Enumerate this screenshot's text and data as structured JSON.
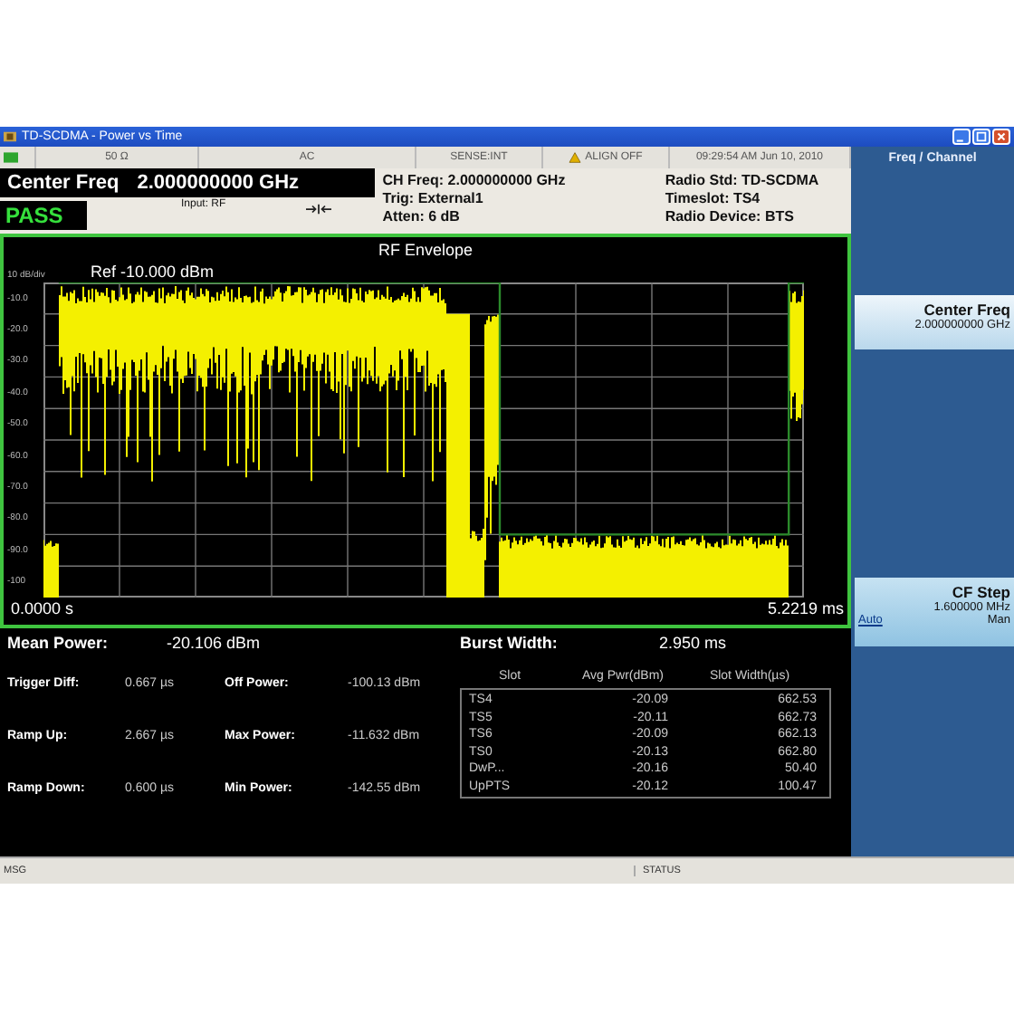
{
  "window": {
    "title": "TD-SCDMA - Power vs Time"
  },
  "status_bar": {
    "items": [
      {
        "text": "50 Ω",
        "kind": "plain"
      },
      {
        "text": "AC",
        "kind": "plain"
      },
      {
        "text": "SENSE:INT",
        "kind": "plain"
      },
      {
        "text": "ALIGN OFF",
        "kind": "warning"
      },
      {
        "text": "09:29:54 AM Jun 10, 2010",
        "kind": "plain"
      }
    ]
  },
  "header": {
    "center_freq_label": "Center Freq",
    "center_freq_value": "2.000000000 GHz",
    "result": {
      "text": "PASS",
      "passed": true
    },
    "input": "Input: RF",
    "middle": [
      "CH Freq: 2.000000000 GHz",
      "Trig: External1",
      "Atten: 6 dB"
    ],
    "right": [
      "Radio Std: TD-SCDMA",
      "Timeslot: TS4",
      "Radio Device: BTS"
    ]
  },
  "plot": {
    "title": "RF Envelope",
    "scale": "10 dB/div",
    "ref": "Ref -10.000 dBm",
    "y_axis_labels": [
      "-10.0",
      "-20.0",
      "-30.0",
      "-40.0",
      "-50.0",
      "-60.0",
      "-70.0",
      "-80.0",
      "-90.0",
      "-100"
    ],
    "x_start": "0.0000 s",
    "x_stop": "5.2219 ms"
  },
  "results": {
    "mean_power_label": "Mean Power:",
    "mean_power": "-20.106 dBm",
    "burst_width_label": "Burst Width:",
    "burst_width": "2.950 ms",
    "metrics": [
      {
        "label": "Trigger Diff:",
        "value": "0.667 µs"
      },
      {
        "label": "Off Power:",
        "value": "-100.13 dBm"
      },
      {
        "label": "Ramp Up:",
        "value": "2.667 µs"
      },
      {
        "label": "Max Power:",
        "value": "-11.632 dBm"
      },
      {
        "label": "Ramp Down:",
        "value": "0.600 µs"
      },
      {
        "label": "Min Power:",
        "value": "-142.55 dBm"
      }
    ],
    "table": {
      "columns": [
        "Slot",
        "Avg Pwr(dBm)",
        "Slot Width(µs)"
      ],
      "rows": [
        [
          "TS4",
          "-20.09",
          "662.53"
        ],
        [
          "TS5",
          "-20.11",
          "662.73"
        ],
        [
          "TS6",
          "-20.09",
          "662.13"
        ],
        [
          "TS0",
          "-20.13",
          "662.80"
        ],
        [
          "DwP...",
          "-20.16",
          "50.40"
        ],
        [
          "UpPTS",
          "-20.12",
          "100.47"
        ]
      ]
    }
  },
  "bottom_bar": {
    "message_label": "MSG",
    "status_label": "STATUS"
  },
  "side_panel": {
    "title": "Freq / Channel",
    "softkeys": [
      {
        "kind": "value",
        "label": "Center Freq",
        "value": "2.000000000 GHz"
      },
      {
        "kind": "toggle",
        "label": "CF Step",
        "value": "1.600000 MHz",
        "options": [
          {
            "label": "Auto",
            "selected": true
          },
          {
            "label": "Man",
            "selected": false
          }
        ]
      }
    ]
  }
}
